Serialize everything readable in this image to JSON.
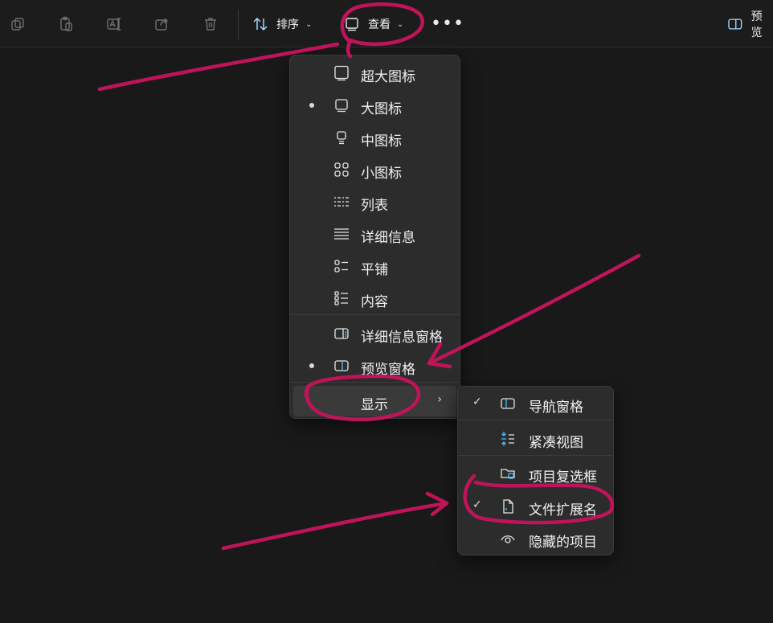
{
  "toolbar": {
    "icons": [
      "copy-icon",
      "paste-icon",
      "rename-icon",
      "share-icon",
      "delete-icon"
    ],
    "sort_label": "排序",
    "view_label": "查看",
    "preview_label": "预览"
  },
  "view_menu": {
    "items": [
      {
        "label": "超大图标",
        "icon": "extra-large-icons-icon",
        "selected": false
      },
      {
        "label": "大图标",
        "icon": "large-icons-icon",
        "selected": true
      },
      {
        "label": "中图标",
        "icon": "medium-icons-icon",
        "selected": false
      },
      {
        "label": "小图标",
        "icon": "small-icons-icon",
        "selected": false
      },
      {
        "label": "列表",
        "icon": "list-icon",
        "selected": false
      },
      {
        "label": "详细信息",
        "icon": "details-icon",
        "selected": false
      },
      {
        "label": "平铺",
        "icon": "tiles-icon",
        "selected": false
      },
      {
        "label": "内容",
        "icon": "content-icon",
        "selected": false
      }
    ],
    "pane_items": [
      {
        "label": "详细信息窗格",
        "icon": "details-pane-icon",
        "selected": false
      },
      {
        "label": "预览窗格",
        "icon": "preview-pane-icon",
        "selected": true
      }
    ],
    "show_label": "显示"
  },
  "show_submenu": {
    "items": [
      {
        "label": "导航窗格",
        "icon": "navigation-pane-icon",
        "checked": true
      },
      {
        "label": "紧凑视图",
        "icon": "compact-view-icon",
        "checked": false
      },
      {
        "label": "项目复选框",
        "icon": "item-checkbox-icon",
        "checked": false
      },
      {
        "label": "文件扩展名",
        "icon": "file-extension-icon",
        "checked": true
      },
      {
        "label": "隐藏的项目",
        "icon": "hidden-items-icon",
        "checked": false
      }
    ]
  },
  "colors": {
    "accent_blue": "#4cc2ff",
    "annotation": "#c0145a",
    "menu_bg": "#2c2c2c",
    "background": "#191919"
  }
}
